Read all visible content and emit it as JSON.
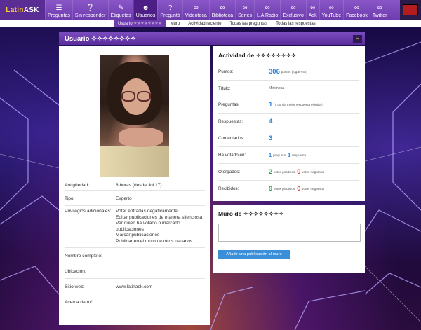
{
  "logo": {
    "text_a": "Latin",
    "text_b": "ASK"
  },
  "nav": [
    {
      "label": "Preguntas",
      "icon": "list-icon"
    },
    {
      "label": "Sin responder",
      "icon": "question-bubble-icon"
    },
    {
      "label": "Etiquetas",
      "icon": "tag-icon"
    },
    {
      "label": "Usuarios",
      "icon": "users-icon"
    },
    {
      "label": "Preguntá",
      "icon": "question-mark-icon"
    },
    {
      "label": "Videoteca",
      "icon": "infinity-icon"
    },
    {
      "label": "Biblioteca",
      "icon": "infinity-icon"
    },
    {
      "label": "Series",
      "icon": "infinity-icon"
    },
    {
      "label": "L.A Radio",
      "icon": "infinity-icon"
    },
    {
      "label": "Exclusivo",
      "icon": "infinity-icon"
    },
    {
      "label": "Ask",
      "icon": "infinity-icon"
    },
    {
      "label": "YouTube",
      "icon": "infinity-icon"
    },
    {
      "label": "Facebook",
      "icon": "infinity-icon"
    },
    {
      "label": "Twitter",
      "icon": "infinity-icon"
    }
  ],
  "subnav": [
    "Usuario ✧✧✧✧✧✧✧✧",
    "Muro",
    "Actividad reciente",
    "Todas las preguntas",
    "Todas las respuestas"
  ],
  "header": {
    "title": "Usuario ✧✧✧✧✧✧✧✧"
  },
  "profile": {
    "antiguedad_label": "Antigüedad:",
    "antiguedad": "8 horas (desde Jul 17)",
    "tipo_label": "Tipo:",
    "tipo": "Experto",
    "priv_label": "Privilegios adicionales:",
    "privilegios": [
      "Votar entradas negativamente",
      "Editar publicaciones de manera silenciosa",
      "Ver quién ha votado o marcado publicaciones",
      "Marcar publicaciones",
      "Publicar en el muro de otros usuarios"
    ],
    "nombre_label": "Nombre completo:",
    "nombre": "",
    "ubicacion_label": "Ubicación:",
    "ubicacion": "",
    "web_label": "Sitio web:",
    "web": "www.latinask.com",
    "acerca_label": "Acerca de mí:",
    "acerca": ""
  },
  "activity": {
    "title": "Actividad de ✧✧✧✧✧✧✧✧",
    "puntos_label": "Puntos:",
    "puntos": "306",
    "puntos_note": "puntos (lugar #40)",
    "titulo_label": "Título:",
    "titulo": "Minimosa",
    "preguntas_label": "Preguntas:",
    "preguntas": "1",
    "preguntas_note": "(1 con la mejor respuesta elegida)",
    "respuestas_label": "Respuestas:",
    "respuestas": "4",
    "comentarios_label": "Comentarios:",
    "comentarios": "3",
    "votado_label": "Ha votado en:",
    "votado_preg": "1",
    "votado_preg_note": "pregunta,",
    "votado_resp": "1",
    "votado_resp_note": "respuesta",
    "otorgados_label": "Otorgados:",
    "otorgados_pos": "2",
    "otorgados_pos_note": "votos positivos,",
    "otorgados_neg": "0",
    "otorgados_neg_note": "votos negativos",
    "recibidos_label": "Recibidos:",
    "recibidos_pos": "9",
    "recibidos_pos_note": "votos positivos,",
    "recibidos_neg": "0",
    "recibidos_neg_note": "votos negativos"
  },
  "wall": {
    "title": "Muro de ✧✧✧✧✧✧✧✧",
    "textarea_value": "",
    "button": "Añadir una publicación al muro"
  },
  "colors": {
    "accent": "#6e3cae",
    "blue": "#2e86de",
    "green": "#27a34a",
    "red": "#d63a3a"
  }
}
